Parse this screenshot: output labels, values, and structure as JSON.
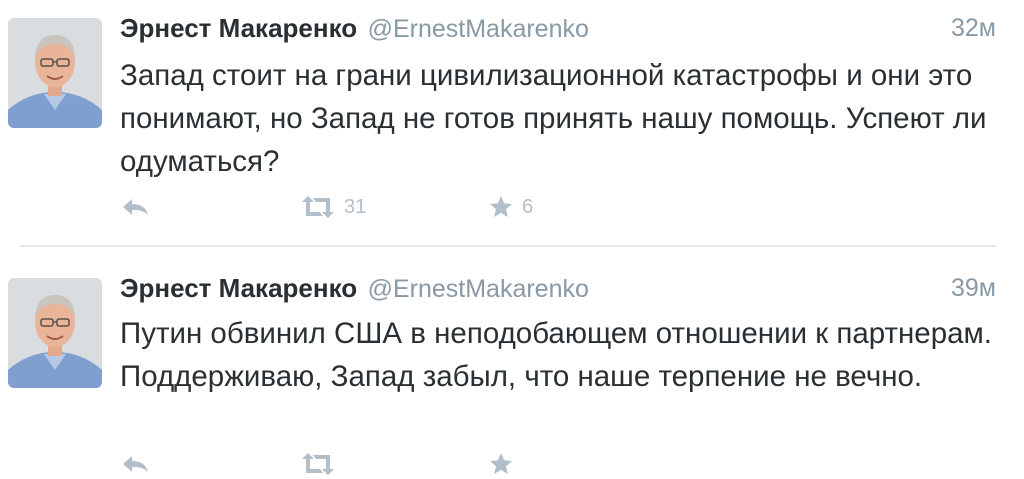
{
  "colors": {
    "name": "#292f33",
    "muted": "#8899a6",
    "action_icon": "#b2bec9",
    "divider": "#e1e8ed"
  },
  "tweets": [
    {
      "author_name": "Эрнест Макаренко",
      "author_handle": "@ErnestMakarenko",
      "time": "32м",
      "text_lines": [
        "Запад стоит на грани цивилизационной катастрофы и они это понимают, но Запад не готов принять нашу помощь. Успеют ли одуматься?"
      ],
      "retweet_count": "31",
      "favorite_count": "6",
      "icons": [
        "reply-icon",
        "retweet-icon",
        "star-icon"
      ]
    },
    {
      "author_name": "Эрнест Макаренко",
      "author_handle": "@ErnestMakarenko",
      "time": "39м",
      "text_lines": [
        "Путин обвинил США в неподобающем отношении к партнерам.",
        "Поддерживаю, Запад забыл, что наше терпение не вечно."
      ],
      "icons": [
        "reply-icon",
        "retweet-icon",
        "star-icon"
      ]
    }
  ]
}
